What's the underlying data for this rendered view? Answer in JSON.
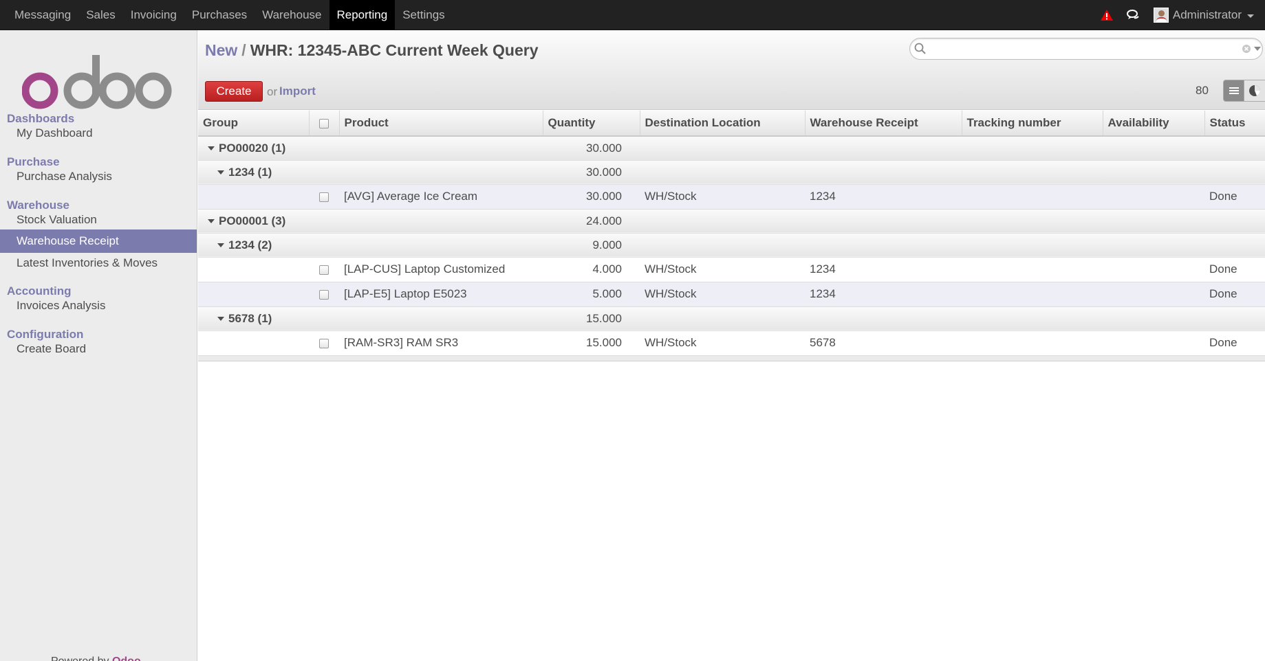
{
  "topbar": {
    "menu": [
      "Messaging",
      "Sales",
      "Invoicing",
      "Purchases",
      "Warehouse",
      "Reporting",
      "Settings"
    ],
    "active": "Reporting",
    "user": "Administrator"
  },
  "sidebar": {
    "sections": [
      {
        "title": "Dashboards",
        "items": [
          "My Dashboard"
        ]
      },
      {
        "title": "Purchase",
        "items": [
          "Purchase Analysis"
        ]
      },
      {
        "title": "Warehouse",
        "items": [
          "Stock Valuation",
          "Warehouse Receipt",
          "Latest Inventories & Moves"
        ]
      },
      {
        "title": "Accounting",
        "items": [
          "Invoices Analysis"
        ]
      },
      {
        "title": "Configuration",
        "items": [
          "Create Board"
        ]
      }
    ],
    "active_item": "Warehouse Receipt",
    "powered_by": "Powered by",
    "powered_brand": "Odoo"
  },
  "header": {
    "breadcrumb_link": "New",
    "breadcrumb_sep": "/",
    "title": "WHR: 12345-ABC Current Week Query",
    "search_placeholder": "",
    "create_label": "Create",
    "or_label": "or",
    "import_label": "Import",
    "pager": "80"
  },
  "table": {
    "columns": [
      "Group",
      "",
      "Product",
      "Quantity",
      "Destination Location",
      "Warehouse Receipt",
      "Tracking number",
      "Availability",
      "Status"
    ],
    "rows": [
      {
        "type": "group",
        "level": 1,
        "label": "PO00020 (1)",
        "qty": "30.000"
      },
      {
        "type": "group",
        "level": 2,
        "label": "1234 (1)",
        "qty": "30.000"
      },
      {
        "type": "record",
        "product": "[AVG] Average Ice Cream",
        "qty": "30.000",
        "dest": "WH/Stock",
        "receipt": "1234",
        "tracking": "",
        "availability": "",
        "status": "Done"
      },
      {
        "type": "group",
        "level": 1,
        "label": "PO00001 (3)",
        "qty": "24.000"
      },
      {
        "type": "group",
        "level": 2,
        "label": "1234 (2)",
        "qty": "9.000"
      },
      {
        "type": "record",
        "product": "[LAP-CUS] Laptop Customized",
        "qty": "4.000",
        "dest": "WH/Stock",
        "receipt": "1234",
        "tracking": "",
        "availability": "",
        "status": "Done"
      },
      {
        "type": "record",
        "product": "[LAP-E5] Laptop E5023",
        "qty": "5.000",
        "dest": "WH/Stock",
        "receipt": "1234",
        "tracking": "",
        "availability": "",
        "status": "Done"
      },
      {
        "type": "group",
        "level": 2,
        "label": "5678 (1)",
        "qty": "15.000"
      },
      {
        "type": "record",
        "product": "[RAM-SR3] RAM SR3",
        "qty": "15.000",
        "dest": "WH/Stock",
        "receipt": "5678",
        "tracking": "",
        "availability": "",
        "status": "Done"
      }
    ]
  },
  "colors": {
    "accent": "#7c7bad",
    "create": "#c12b2b",
    "topbar": "#222222",
    "brand": "#a24689"
  },
  "icons": {
    "alert": "warning-triangle-icon",
    "chat": "chat-bubbles-icon",
    "search": "search-icon",
    "clear": "clear-circle-icon",
    "list_view": "list-view-icon",
    "graph_view": "graph-view-icon"
  }
}
